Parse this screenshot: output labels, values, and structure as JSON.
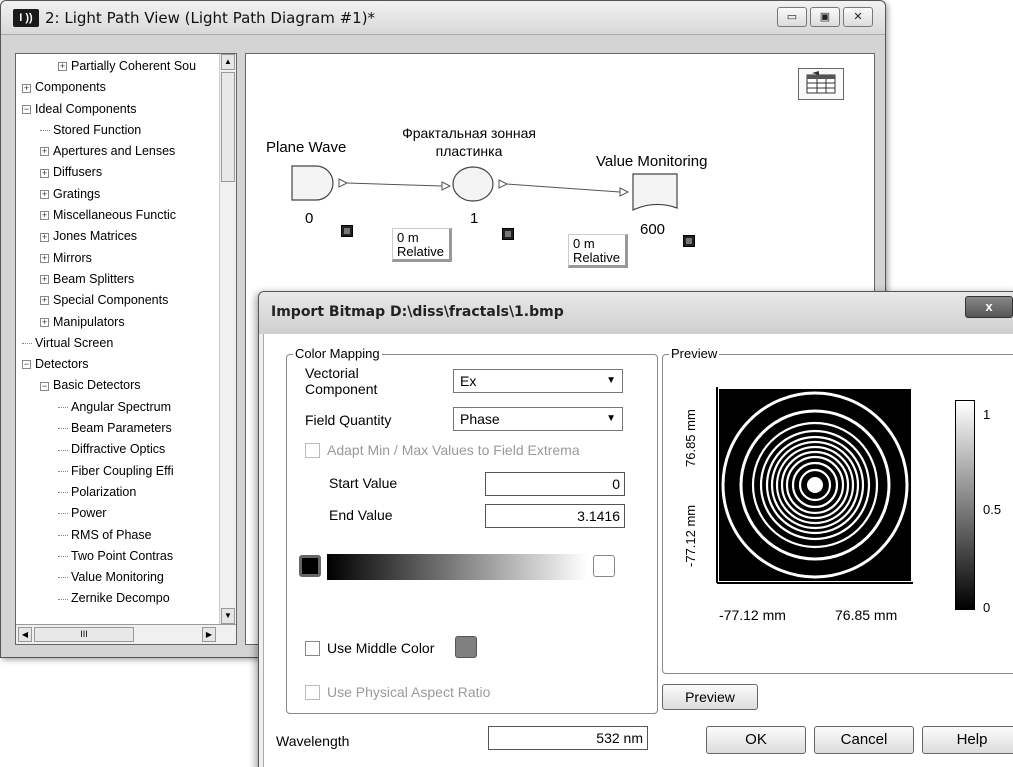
{
  "main_window": {
    "icon_text": "I ))",
    "title": "2: Light Path View (Light Path Diagram #1)*",
    "buttons": {
      "minimize": "▭",
      "restore": "▣",
      "close": "✕"
    }
  },
  "tree": {
    "items": [
      {
        "label": "Partially Coherent Sou",
        "level": 2,
        "type": "expand"
      },
      {
        "label": "Components",
        "level": 0,
        "type": "expand"
      },
      {
        "label": "Ideal Components",
        "level": 0,
        "type": "collapse"
      },
      {
        "label": "Stored Function",
        "level": 1,
        "type": "leaf"
      },
      {
        "label": "Apertures and Lenses",
        "level": 1,
        "type": "expand"
      },
      {
        "label": "Diffusers",
        "level": 1,
        "type": "expand"
      },
      {
        "label": "Gratings",
        "level": 1,
        "type": "expand"
      },
      {
        "label": "Miscellaneous Functic",
        "level": 1,
        "type": "expand"
      },
      {
        "label": "Jones Matrices",
        "level": 1,
        "type": "expand"
      },
      {
        "label": "Mirrors",
        "level": 1,
        "type": "expand"
      },
      {
        "label": "Beam Splitters",
        "level": 1,
        "type": "expand"
      },
      {
        "label": "Special Components",
        "level": 1,
        "type": "expand"
      },
      {
        "label": "Manipulators",
        "level": 1,
        "type": "expand"
      },
      {
        "label": "Virtual Screen",
        "level": 0,
        "type": "leaf"
      },
      {
        "label": "Detectors",
        "level": 0,
        "type": "collapse"
      },
      {
        "label": "Basic Detectors",
        "level": 1,
        "type": "collapse"
      },
      {
        "label": "Angular Spectrum",
        "level": 2,
        "type": "leaf"
      },
      {
        "label": "Beam Parameters",
        "level": 2,
        "type": "leaf"
      },
      {
        "label": "Diffractive Optics",
        "level": 2,
        "type": "leaf"
      },
      {
        "label": "Fiber Coupling Effi",
        "level": 2,
        "type": "leaf"
      },
      {
        "label": "Polarization",
        "level": 2,
        "type": "leaf"
      },
      {
        "label": "Power",
        "level": 2,
        "type": "leaf"
      },
      {
        "label": "RMS of Phase",
        "level": 2,
        "type": "leaf"
      },
      {
        "label": "Two Point Contras",
        "level": 2,
        "type": "leaf"
      },
      {
        "label": "Value Monitoring",
        "level": 2,
        "type": "leaf"
      },
      {
        "label": "Zernike Decompo",
        "level": 2,
        "type": "leaf"
      }
    ],
    "hscroll_thumb": "III"
  },
  "diagram": {
    "nodes": [
      {
        "label": "Plane Wave",
        "number": "0"
      },
      {
        "label": "Фрактальная зонная\nпластинка",
        "number": "1"
      },
      {
        "label": "Value Monitoring",
        "number": "600"
      }
    ],
    "relative_boxes": [
      {
        "distance": "0 m",
        "mode": "Relative"
      },
      {
        "distance": "0 m",
        "mode": "Relative"
      }
    ]
  },
  "dialog": {
    "title": "Import Bitmap D:\\diss\\fractals\\1.bmp",
    "close": "x",
    "color_mapping": {
      "group_title": "Color Mapping",
      "vectorial_label": "Vectorial\nComponent",
      "vectorial_value": "Ex",
      "field_quantity_label": "Field Quantity",
      "field_quantity_value": "Phase",
      "adapt_label": "Adapt Min / Max Values to Field Extrema",
      "start_label": "Start Value",
      "start_value": "0",
      "end_label": "End Value",
      "end_value": "3.1416",
      "use_middle_color_label": "Use Middle Color",
      "use_physical_aspect_label": "Use Physical Aspect Ratio"
    },
    "preview": {
      "group_title": "Preview",
      "y_top": "76.85 mm",
      "y_bottom": "-77.12 mm",
      "x_left": "-77.12 mm",
      "x_right": "76.85 mm",
      "scale_max": "1",
      "scale_mid": "0.5",
      "scale_min": "0",
      "preview_button": "Preview"
    },
    "wavelength_label": "Wavelength",
    "wavelength_value": "532 nm",
    "ok": "OK",
    "cancel": "Cancel",
    "help": "Help"
  },
  "colors": {
    "titlebar": "#d8d8d8",
    "swatch_start": "#000000",
    "swatch_end": "#ffffff",
    "swatch_middle": "#808080"
  }
}
